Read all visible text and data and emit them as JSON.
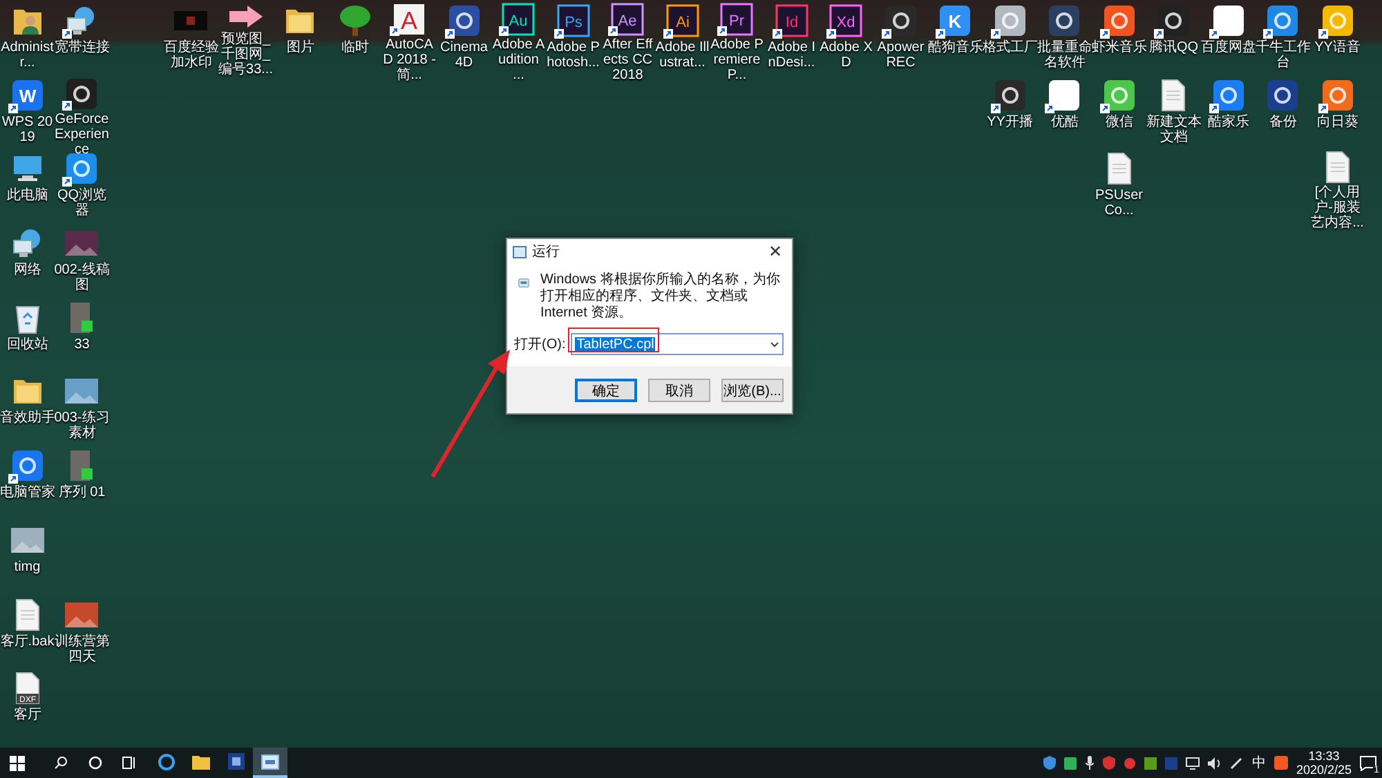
{
  "desktop_icons": [
    {
      "label": "Administr...",
      "kind": "user",
      "shortcut": false
    },
    {
      "label": "宽带连接",
      "kind": "network",
      "shortcut": true
    },
    {
      "label": "百度经验加水印",
      "kind": "black",
      "shortcut": false
    },
    {
      "label": "预览图_千图网_编号33...",
      "kind": "arrow",
      "shortcut": false
    },
    {
      "label": "图片",
      "kind": "folder",
      "shortcut": false
    },
    {
      "label": "临时",
      "kind": "tree",
      "shortcut": false
    },
    {
      "label": "AutoCAD 2018 - 简...",
      "kind": "letter",
      "glyph": "A",
      "color": "#d0202e",
      "shortcut": true
    },
    {
      "label": "Cinema 4D",
      "kind": "app",
      "color": "#2a4fa0",
      "shortcut": true
    },
    {
      "label": "Adobe Audition ...",
      "kind": "adobe",
      "glyph": "Au",
      "color": "#00e4bb",
      "shortcut": true
    },
    {
      "label": "Adobe Photosh...",
      "kind": "adobe",
      "glyph": "Ps",
      "color": "#31a8ff",
      "shortcut": true
    },
    {
      "label": "After Effects CC 2018",
      "kind": "adobe",
      "glyph": "Ae",
      "color": "#d291ff",
      "shortcut": true
    },
    {
      "label": "Adobe Illustrat...",
      "kind": "adobe",
      "glyph": "Ai",
      "color": "#ff9a00",
      "shortcut": true
    },
    {
      "label": "Adobe Premiere P...",
      "kind": "adobe",
      "glyph": "Pr",
      "color": "#ea77ff",
      "shortcut": true
    },
    {
      "label": "Adobe InDesi...",
      "kind": "adobe",
      "glyph": "Id",
      "color": "#ff3366",
      "shortcut": true
    },
    {
      "label": "Adobe XD",
      "kind": "adobe",
      "glyph": "Xd",
      "color": "#ff61f6",
      "shortcut": true
    },
    {
      "label": "ApowerREC",
      "kind": "app",
      "color": "#2a2a2a",
      "shortcut": true
    },
    {
      "label": "酷狗音乐",
      "kind": "app",
      "glyph": "K",
      "color": "#2f8ff2",
      "shortcut": true
    },
    {
      "label": "格式工厂",
      "kind": "app",
      "color": "#b0b8c0",
      "shortcut": true
    },
    {
      "label": "批量重命名软件",
      "kind": "app",
      "color": "#2a4060",
      "shortcut": false
    },
    {
      "label": "虾米音乐",
      "kind": "app",
      "color": "#f3541f",
      "shortcut": true
    },
    {
      "label": "腾讯QQ",
      "kind": "app",
      "color": "#222222",
      "shortcut": true
    },
    {
      "label": "百度网盘",
      "kind": "app",
      "color": "#ffffff",
      "shortcut": true
    },
    {
      "label": "千牛工作台",
      "kind": "app",
      "color": "#1e88e5",
      "shortcut": true
    },
    {
      "label": "YY语音",
      "kind": "app",
      "color": "#f5b800",
      "shortcut": true
    },
    {
      "label": "WPS 2019",
      "kind": "app",
      "glyph": "W",
      "color": "#1a72f0",
      "shortcut": true
    },
    {
      "label": "GeForce Experience",
      "kind": "app",
      "color": "#1f1f1f",
      "shortcut": true
    },
    {
      "label": "YY开播",
      "kind": "app",
      "color": "#2a2a2a",
      "shortcut": true
    },
    {
      "label": "优酷",
      "kind": "app",
      "color": "#ffffff",
      "shortcut": true
    },
    {
      "label": "微信",
      "kind": "app",
      "color": "#4cc74c",
      "shortcut": true
    },
    {
      "label": "新建文本文档",
      "kind": "doc",
      "shortcut": false
    },
    {
      "label": "酷家乐",
      "kind": "app",
      "color": "#1b7cf5",
      "shortcut": true
    },
    {
      "label": "备份",
      "kind": "app",
      "color": "#1a3f8f",
      "shortcut": false
    },
    {
      "label": "向日葵",
      "kind": "app",
      "color": "#f26b1d",
      "shortcut": true
    },
    {
      "label": "此电脑",
      "kind": "computer",
      "shortcut": false
    },
    {
      "label": "QQ浏览器",
      "kind": "app",
      "color": "#1a8ff0",
      "shortcut": true
    },
    {
      "label": "PSUserCo...",
      "kind": "doc",
      "shortcut": false
    },
    {
      "label": "[个人用户-服装艺内容...",
      "kind": "doc",
      "shortcut": false
    },
    {
      "label": "网络",
      "kind": "network",
      "shortcut": false
    },
    {
      "label": "002-线稿图",
      "kind": "image",
      "color": "#5a2a4a",
      "shortcut": false
    },
    {
      "label": "回收站",
      "kind": "recycle",
      "shortcut": false
    },
    {
      "label": "33",
      "kind": "video",
      "shortcut": false
    },
    {
      "label": "音效助手",
      "kind": "folder",
      "shortcut": false
    },
    {
      "label": "003-练习素材",
      "kind": "image",
      "color": "#6aa0c8",
      "shortcut": false
    },
    {
      "label": "电脑管家",
      "kind": "app",
      "color": "#1976f0",
      "shortcut": true
    },
    {
      "label": "序列 01",
      "kind": "video",
      "shortcut": false
    },
    {
      "label": "timg",
      "kind": "image",
      "color": "#9fb0bd",
      "shortcut": false
    },
    {
      "label": "客厅.bak",
      "kind": "doc",
      "shortcut": false
    },
    {
      "label": "训练营第四天",
      "kind": "image",
      "color": "#c8482c",
      "shortcut": false
    },
    {
      "label": "客厅",
      "kind": "doc",
      "glyph": "DXF",
      "shortcut": false
    }
  ],
  "run_dialog": {
    "title": "运行",
    "close_glyph": "✕",
    "message": "Windows 将根据你所输入的名称，为你打开相应的程序、文件夹、文档或 Internet 资源。",
    "open_label": "打开(O):",
    "value": "TabletPC.cpl",
    "value_selected": true,
    "buttons": [
      {
        "label": "确定",
        "default": true
      },
      {
        "label": "取消",
        "default": false
      },
      {
        "label": "浏览(B)...",
        "default": false
      }
    ]
  },
  "taskbar": {
    "pinned": [
      {
        "kind": "browser",
        "active": false
      },
      {
        "kind": "explorer",
        "active": false
      },
      {
        "kind": "app",
        "active": false
      },
      {
        "kind": "run",
        "active": true
      }
    ],
    "ime": "中",
    "time": "13:33",
    "date": "2020/2/25",
    "notifications": "1"
  }
}
